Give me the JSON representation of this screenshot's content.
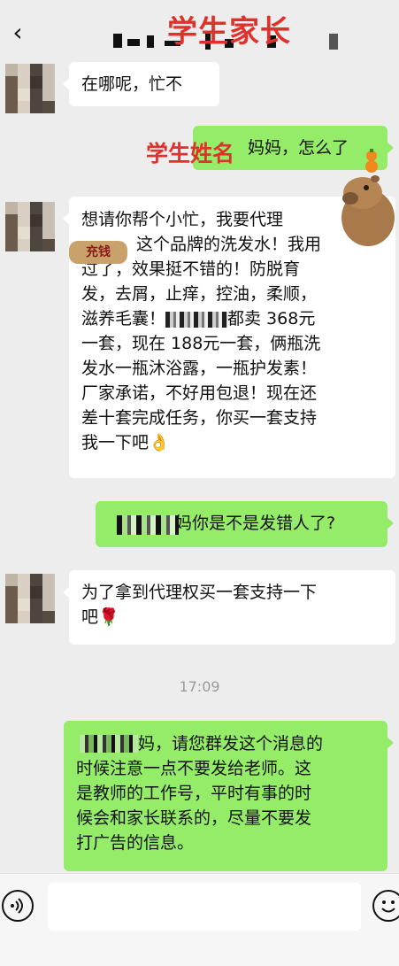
{
  "header": {
    "back_icon": "chevron-left-icon",
    "title_overlay": "学生家长"
  },
  "overlays": {
    "student_name": "学生姓名"
  },
  "messages": [
    {
      "side": "left",
      "text": "在哪呢，忙不"
    },
    {
      "side": "right",
      "text": "妈妈，怎么了"
    },
    {
      "side": "left",
      "line1": "想请你帮个小忙，我要代理",
      "line2": "这个品牌的洗发水！我用",
      "line3": "过了，效果挺不错的！防脱育",
      "line4": "发，去屑，止痒，控油，柔顺，",
      "line5": "滋养毛囊！",
      "line5b": "都卖 368元",
      "line6": "一套，现在 188元一套，俩瓶洗",
      "line7": "发水一瓶沐浴露，一瓶护发素！",
      "line8": "厂家承诺，不好用包退！现在还",
      "line9": "差十套完成任务，你买一套支持",
      "line10": "我一下吧👌",
      "badge": "充钱"
    },
    {
      "side": "right",
      "text": "妈你是不是发错人了?"
    },
    {
      "side": "left",
      "line1": "为了拿到代理权买一套支持一下",
      "line2": "吧🌹"
    },
    {
      "side": "right",
      "line1": "妈，请您群发这个消息的",
      "line2": "时候注意一点不要发给老师。这",
      "line3": "是教师的工作号，平时有事的时",
      "line4": "候会和家长联系的，尽量不要发",
      "line5": "打广告的信息。"
    }
  ],
  "timestamp": "17:09",
  "composer": {
    "voice_icon": "voice-icon",
    "emoji_icon": "emoji-icon"
  },
  "colors": {
    "bg": "#ededed",
    "sent": "#95ec69",
    "received": "#ffffff",
    "overlay_red": "#e0322d"
  }
}
